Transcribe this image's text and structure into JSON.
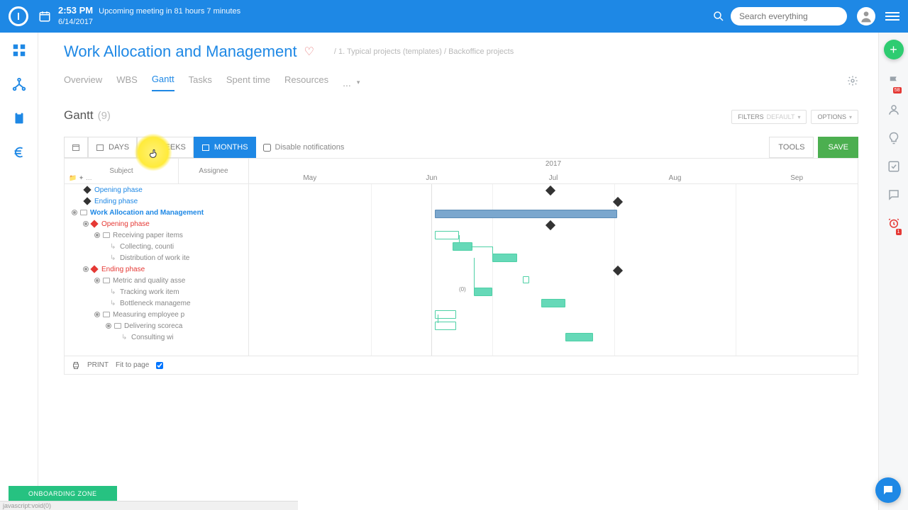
{
  "header": {
    "time": "2:53 PM",
    "meeting_note": "Upcoming meeting in 81 hours 7 minutes",
    "date": "6/14/2017",
    "search_placeholder": "Search everything"
  },
  "page": {
    "title": "Work Allocation and Management",
    "breadcrumb": "/  1. Typical projects (templates)  /  Backoffice projects"
  },
  "tabs": {
    "t0": "Overview",
    "t1": "WBS",
    "t2": "Gantt",
    "t3": "Tasks",
    "t4": "Spent time",
    "t5": "Resources",
    "more": "..."
  },
  "section": {
    "title": "Gantt",
    "count": "(9)",
    "filters": "FILTERS",
    "filters_val": "DEFAULT",
    "options": "OPTIONS"
  },
  "scale": {
    "days": "DAYS",
    "weeks": "WEEKS",
    "months": "MONTHS",
    "disable_notifications": "Disable notifications",
    "tools": "TOOLS",
    "save": "SAVE"
  },
  "columns": {
    "subject": "Subject",
    "assignee": "Assignee"
  },
  "timeline": {
    "year": "2017",
    "m0": "May",
    "m1": "Jun",
    "m2": "Jul",
    "m3": "Aug",
    "m4": "Sep"
  },
  "tree": {
    "r1": "Opening phase",
    "r2": "Ending phase",
    "r3": "Work Allocation and Management",
    "r4": "Opening phase",
    "r5": "Receiving paper items",
    "r6": "Collecting, counti",
    "r7": "Distribution of work ite",
    "r8": "Ending phase",
    "r9": "Metric and quality asse",
    "r10": "Tracking work item",
    "r11": "Bottleneck manageme",
    "r12": "Measuring employee p",
    "r13": "Delivering scoreca",
    "r14": "Consulting wi"
  },
  "printbar": {
    "print": "PRINT",
    "fit": "Fit to page"
  },
  "onboarding": "ONBOARDING ZONE",
  "footer_stub": "javascript:void(0)",
  "chart_data": {
    "type": "gantt",
    "time_axis": {
      "year": 2017,
      "months": [
        "May",
        "Jun",
        "Jul",
        "Aug",
        "Sep"
      ],
      "today": "2017-06-14"
    },
    "rows": [
      {
        "label": "Opening phase",
        "kind": "milestone",
        "month": "Jul"
      },
      {
        "label": "Ending phase",
        "kind": "milestone",
        "month": "Aug"
      },
      {
        "label": "Work Allocation and Management",
        "kind": "bar",
        "start": "Jun",
        "end": "Aug",
        "style": "blue"
      },
      {
        "label": "Opening phase (child)",
        "kind": "milestone",
        "month": "Jul"
      },
      {
        "label": "Receiving paper items",
        "kind": "bar",
        "start": "Jun",
        "end": "Jun",
        "style": "green-outline"
      },
      {
        "label": "Collecting, counting",
        "kind": "bar",
        "start": "Jun",
        "end": "Jun",
        "style": "green"
      },
      {
        "label": "Distribution of work items",
        "kind": "bar",
        "start": "Jun",
        "end": "Jul",
        "style": "green"
      },
      {
        "label": "Ending phase (child)",
        "kind": "milestone",
        "month": "Aug"
      },
      {
        "label": "Metric and quality assessment",
        "kind": "bar",
        "start": "Jul",
        "end": "Jul",
        "style": "green-outline"
      },
      {
        "label": "Tracking work item",
        "kind": "bar",
        "start": "Jun",
        "end": "Jun",
        "style": "green"
      },
      {
        "label": "Bottleneck management",
        "kind": "bar",
        "start": "Jul",
        "end": "Jul",
        "style": "green"
      },
      {
        "label": "Measuring employee p",
        "kind": "bar",
        "start": "Jun",
        "end": "Jun",
        "style": "green-outline"
      },
      {
        "label": "Delivering scorecard",
        "kind": "bar",
        "start": "Jun",
        "end": "Jun",
        "style": "green-outline"
      },
      {
        "label": "Consulting with",
        "kind": "bar",
        "start": "Jul",
        "end": "Aug",
        "style": "green"
      }
    ]
  }
}
